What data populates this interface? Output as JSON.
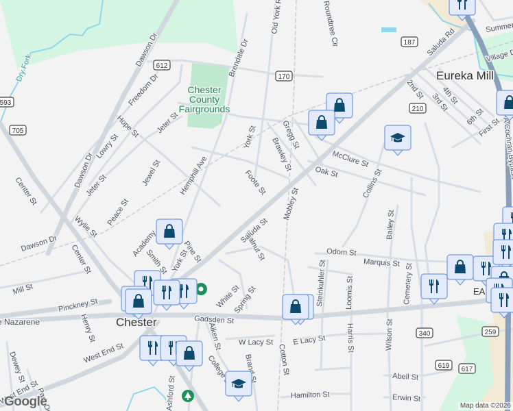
{
  "map": {
    "places": {
      "chester": "Chester",
      "eureka_mill": "Eureka Mill",
      "ea": "EA",
      "nazarene": "e Nazarene"
    },
    "parks": {
      "fairgrounds_1": "Chester",
      "fairgrounds_2": "County",
      "fairgrounds_3": "Fairgrounds"
    },
    "water": {
      "dry_fork": "Dry Fork"
    },
    "streets": {
      "dawson_dr": "Dawson Dr",
      "freedom_dr": "Freedom Dr",
      "hope_st": "Hope St",
      "jeter_st": "Jeter St",
      "lowry_st": "Lowry St",
      "jewel_st": "Jewel St",
      "hemphill_ave": "Hemphill Ave",
      "peace_st": "Peace St",
      "wylie_st": "Wylie St",
      "center_st": "Center St",
      "academy": "Academy",
      "smith_st": "Smith St",
      "york_st": "York St",
      "pine_st": "Pine St",
      "mill_st": "Mill St",
      "pinckney_st": "Pinckney St",
      "henry_st": "Henry St",
      "west_end_st": "West End St",
      "dewey_st": "Dewey St",
      "park_dr": "Park Dr",
      "gadsden_st": "Gadsden St",
      "white_st": "White St",
      "spring_st": "Spring St",
      "aiken_st": "Aiken St",
      "college_st": "College St",
      "w_lacy_st": "W Lacy St",
      "brand_st": "Brand St",
      "ashford_st": "Ashford St",
      "foote_st": "Foote St",
      "walnut_st": "Walnut St",
      "saluda_st": "Saluda St",
      "saluda_rd": "Saluda Rd",
      "brendale_dr": "Brendale Dr",
      "old_york_rd": "Old York Rd",
      "roundtree_cir": "Roundtree Cir",
      "gregg_st": "Gregg St",
      "brawley_st": "Brawley St",
      "mobley_st": "Mobley St",
      "mcclure_st": "McClure St",
      "oak_st": "Oak St",
      "collins_st": "Collins St",
      "bailey_st": "Bailey St",
      "odom_st": "Odom St",
      "marquis_st": "Marquis St",
      "cemetery_st": "Cemetery St",
      "steinkuhler_st": "Steinkuhler St",
      "loomis_st": "Loomis St",
      "harris_st": "Harris St",
      "wilson_st": "Wilson St",
      "e_lacy_st": "E Lacy St",
      "cotton_st": "Cotton St",
      "abell_st": "Abell St",
      "erwin_st": "Erwin St",
      "hamilton_st": "Hamilton St",
      "second_st": "2nd St",
      "third_st": "3rd St",
      "fourth_st": "4th St",
      "sixth_st": "6th St",
      "first_st": "First St",
      "summer": "Summer",
      "village": "Village D",
      "cochran_bypass": "A Cochran Bypass"
    },
    "route_shields": [
      "612",
      "593",
      "705",
      "170",
      "187",
      "210",
      "340",
      "259",
      "619",
      "617"
    ],
    "poi_colors": {
      "pin_fill": "#e3ebfa",
      "pin_border": "#6f9ae0",
      "icon": "#0d4a6e",
      "green_pin": "#1a8f5a"
    },
    "attribution": "Map data ©2026",
    "logo": "Google"
  }
}
